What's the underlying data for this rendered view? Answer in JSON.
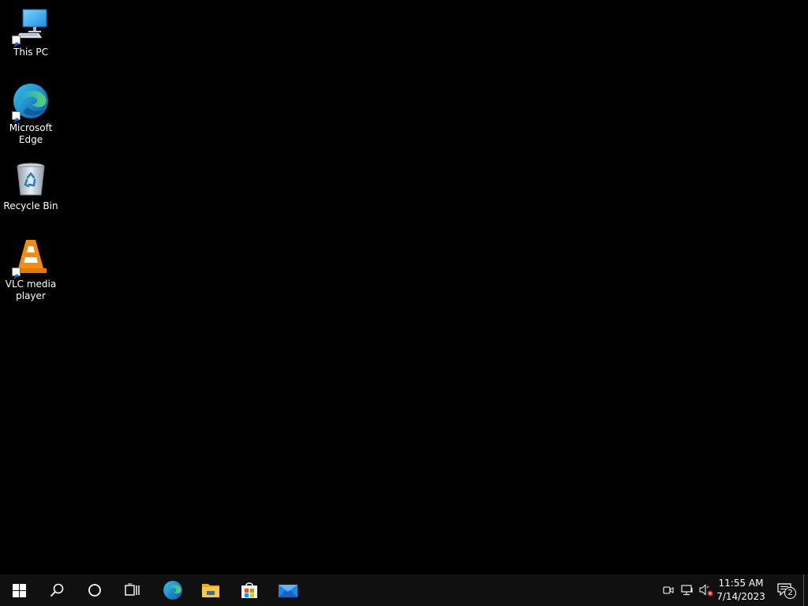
{
  "desktop": {
    "icons": [
      {
        "label": "This PC",
        "icon": "computer-icon"
      },
      {
        "label": "Microsoft Edge",
        "icon": "edge-icon"
      },
      {
        "label": "Recycle Bin",
        "icon": "recycle-bin-icon"
      },
      {
        "label": "VLC media player",
        "icon": "vlc-icon"
      }
    ]
  },
  "taskbar": {
    "buttons": [
      {
        "name": "start",
        "icon": "windows-logo-icon"
      },
      {
        "name": "search",
        "icon": "search-icon"
      },
      {
        "name": "cortana",
        "icon": "cortana-circle-icon"
      },
      {
        "name": "task-view",
        "icon": "task-view-icon"
      },
      {
        "name": "edge",
        "icon": "edge-icon"
      },
      {
        "name": "file-explorer",
        "icon": "folder-icon"
      },
      {
        "name": "microsoft-store",
        "icon": "store-icon"
      },
      {
        "name": "mail",
        "icon": "mail-icon"
      }
    ],
    "tray": {
      "icons": [
        "meet-now-icon",
        "network-icon",
        "volume-muted-icon"
      ],
      "time": "11:55 AM",
      "date": "7/14/2023",
      "notification_count": "2"
    }
  },
  "colors": {
    "desktop_bg": "#000000",
    "taskbar_bg": "#101010",
    "accent": "#0078d7"
  }
}
